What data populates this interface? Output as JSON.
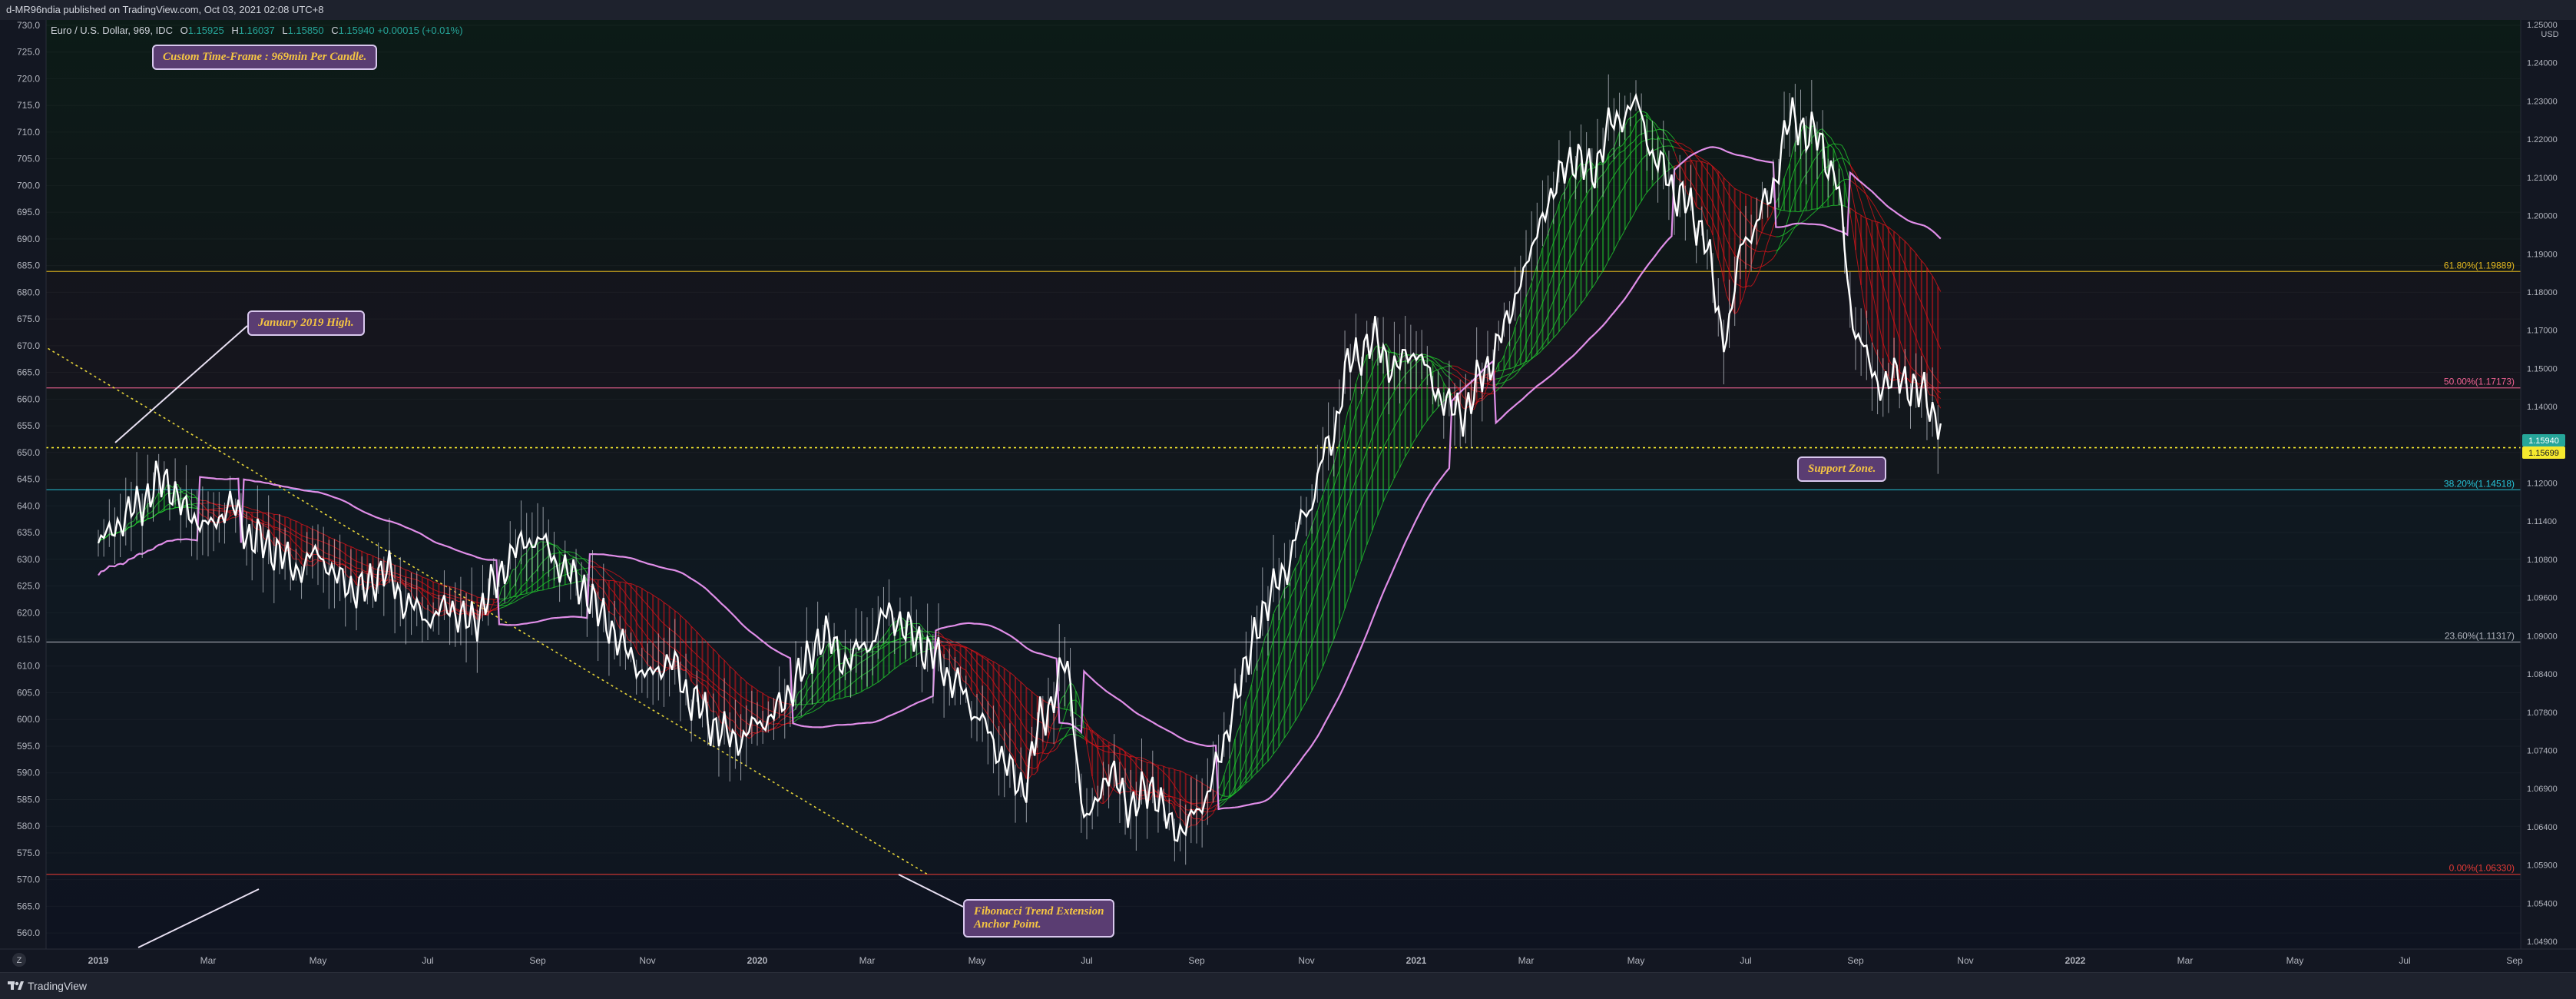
{
  "header": {
    "published": "d-MR96ndia published on TradingView.com, Oct 03, 2021 02:08 UTC+8"
  },
  "legend": {
    "symbol": "Euro / U.S. Dollar, 969, IDC",
    "open_label": "O",
    "open": "1.15925",
    "high_label": "H",
    "high": "1.16037",
    "low_label": "L",
    "low": "1.15850",
    "close_label": "C",
    "close": "1.15940",
    "change": "+0.00015 (+0.01%)"
  },
  "annotations": {
    "timeframe": "Custom Time-Frame : 969min Per Candle.",
    "jan_high": "January 2019 High.",
    "support": "Support Zone.",
    "fib_line1": "Fibonacci Trend Extension",
    "fib_line2": "Anchor Point."
  },
  "footer": {
    "brand": "TradingView",
    "corner": "Z"
  },
  "colors": {
    "background": "#131722",
    "candle_up": "#ffffff",
    "ribbon_up": "#22c92e",
    "ribbon_down": "#d7141a",
    "envelope": "#e08ee8",
    "fib_618": "#e5b91f",
    "fib_50": "#f06292",
    "fib_382": "#26c6da",
    "fib_236": "#b2b5be",
    "fib_0": "#e53935",
    "trendline": "#e5d33a",
    "current_price": "#26a69a",
    "support_price": "#f6e92e"
  },
  "chart_data": {
    "type": "line",
    "title": "Euro / U.S. Dollar, 969, IDC",
    "xlabel": "",
    "ylabel": "",
    "y_unit": "USD",
    "x_ticks": [
      "2019",
      "Mar",
      "May",
      "Jul",
      "Sep",
      "Nov",
      "2020",
      "Mar",
      "May",
      "Jul",
      "Sep",
      "Nov",
      "2021",
      "Mar",
      "May",
      "Jul",
      "Sep",
      "Nov",
      "2022",
      "Mar",
      "May",
      "Jul",
      "Sep"
    ],
    "left_axis": {
      "ticks": [
        "730.0",
        "725.0",
        "720.0",
        "715.0",
        "710.0",
        "705.0",
        "700.0",
        "695.0",
        "690.0",
        "685.0",
        "680.0",
        "675.0",
        "670.0",
        "665.0",
        "660.0",
        "655.0",
        "650.0",
        "645.0",
        "640.0",
        "635.0",
        "630.0",
        "625.0",
        "620.0",
        "615.0",
        "610.0",
        "605.0",
        "600.0",
        "595.0",
        "590.0",
        "585.0",
        "580.0",
        "575.0",
        "570.0",
        "565.0",
        "560.0"
      ],
      "range": [
        557,
        731
      ]
    },
    "right_axis": {
      "ticks": [
        "1.25000",
        "1.24000",
        "1.23000",
        "1.22000",
        "1.21000",
        "1.20000",
        "1.19000",
        "1.18000",
        "1.17000",
        "1.16000",
        "1.15000",
        "1.14000",
        "1.13000",
        "1.12000",
        "1.11000",
        "1.10000",
        "1.09000",
        "1.08000",
        "1.07000",
        "1.06000",
        "1.05000",
        "1.04000"
      ],
      "labels_shown": [
        "1.25000",
        "1.24000",
        "1.23000",
        "1.22000",
        "1.21000",
        "1.20000",
        "1.19000",
        "1.18000",
        "1.17000",
        "1.15000",
        "1.14000",
        "1.13000",
        "1.12000",
        "1.11400",
        "1.10800",
        "1.09600",
        "1.09000",
        "1.08400",
        "1.07800",
        "1.07400",
        "1.06900",
        "1.06400",
        "1.05900",
        "1.05400",
        "1.04900"
      ],
      "current_price": "1.15940",
      "support_price": "1.15699"
    },
    "fib_levels": [
      {
        "label": "61.80%(1.19889)",
        "price": 1.19889,
        "left": 683.9
      },
      {
        "label": "50.00%(1.17173)",
        "price": 1.17173,
        "left": 662.1
      },
      {
        "label": "38.20%(1.14518)",
        "price": 1.14518,
        "left": 643.0
      },
      {
        "label": "23.60%(1.11317)",
        "price": 1.11317,
        "left": 614.5
      },
      {
        "label": "0.00%(1.06330)",
        "price": 1.0633,
        "left": 571.0
      }
    ],
    "support_level": 650.9,
    "trendline": {
      "start": [
        "2018-12",
        670
      ],
      "end": [
        "2020-04",
        571.0
      ]
    },
    "price_series": {
      "name": "",
      "x_months": [
        0,
        0.4,
        0.8,
        1.2,
        1.6,
        2,
        2.4,
        2.8,
        3.2,
        3.6,
        4,
        4.4,
        4.8,
        5.2,
        5.6,
        6,
        6.4,
        6.8,
        7.2,
        7.6,
        8,
        8.4,
        8.8,
        9.2,
        9.6,
        10,
        10.4,
        10.8,
        11.2,
        11.6,
        12,
        12.4,
        12.8,
        13.2,
        13.6,
        14,
        14.4,
        14.8,
        15.2,
        15.6,
        16,
        16.4,
        16.8,
        17.2,
        17.6,
        18,
        18.4,
        18.8,
        19.2,
        19.6,
        20,
        20.4,
        20.8,
        21.2,
        21.6,
        22,
        22.4,
        22.8,
        23.2,
        23.6,
        24,
        24.4,
        24.8,
        25.2,
        25.6,
        26,
        26.4,
        26.8,
        27.2,
        27.6,
        28,
        28.4,
        28.8,
        29.2,
        29.6,
        30,
        30.4,
        30.8,
        31.2,
        31.6,
        32,
        32.4,
        32.8,
        33.2,
        33.6
      ],
      "values": [
        633,
        637,
        641,
        645,
        639,
        636,
        640,
        634,
        632,
        628,
        631,
        626,
        624,
        628,
        622,
        619,
        621,
        618,
        625,
        632,
        634,
        629,
        625,
        619,
        613,
        608,
        611,
        604,
        599,
        596,
        599,
        602,
        609,
        616,
        611,
        614,
        620,
        616,
        612,
        607,
        601,
        594,
        587,
        600,
        610,
        581,
        590,
        584,
        587,
        579,
        582,
        592,
        607,
        620,
        628,
        639,
        651,
        667,
        671,
        666,
        669,
        661,
        657,
        664,
        673,
        685,
        697,
        705,
        703,
        712,
        715,
        704,
        698,
        692,
        672,
        690,
        697,
        712,
        710,
        703,
        673,
        663,
        664,
        661,
        655,
        651
      ]
    },
    "month_index_origin": "2019-01",
    "months_per_x_tick": 2
  }
}
